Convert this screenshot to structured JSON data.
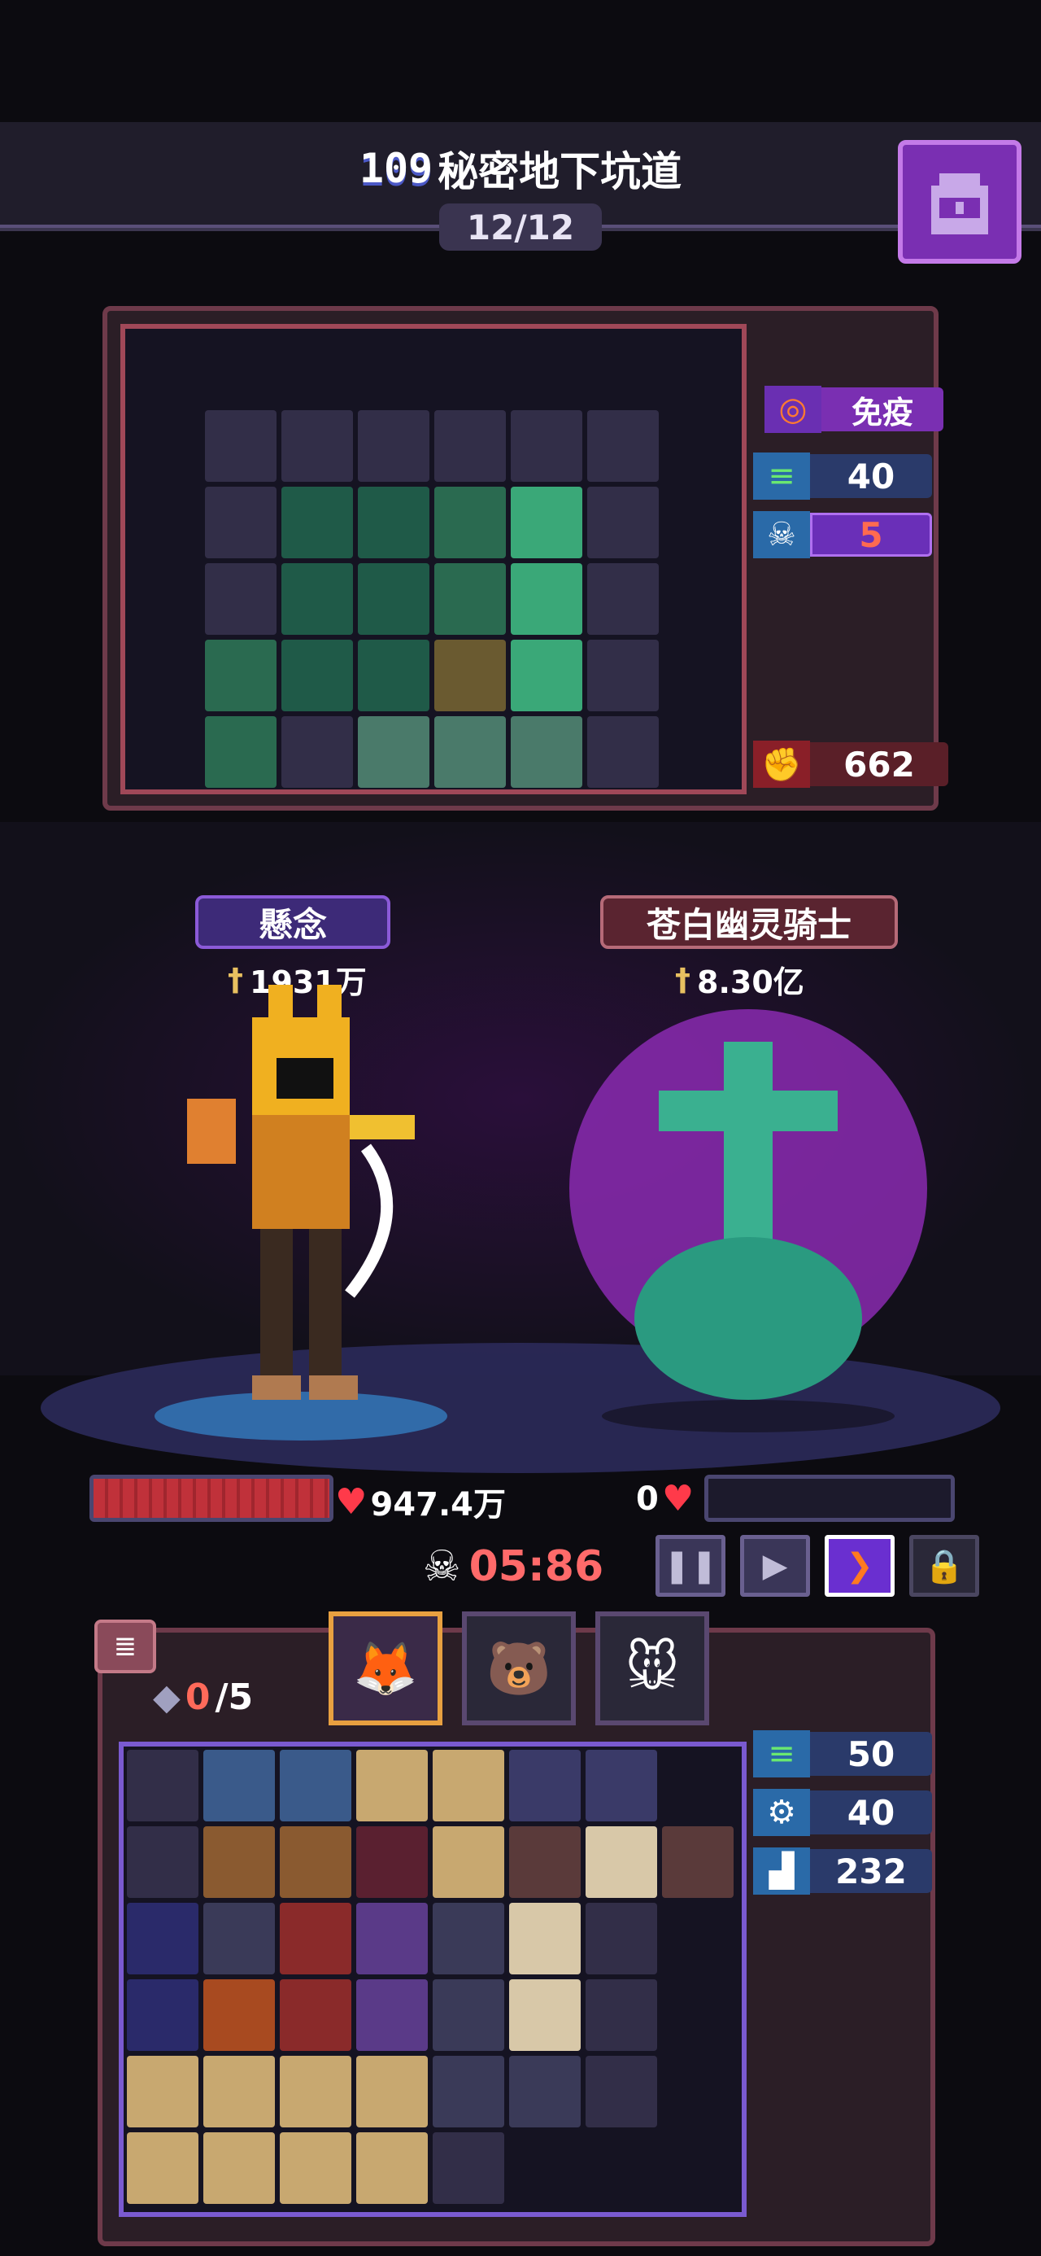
{
  "header": {
    "level": "109",
    "dungeon_name": "秘密地下坑道",
    "floor_progress": "12/12"
  },
  "enemy_stats": {
    "immune_label": "免疫",
    "speed": "40",
    "kills": "5",
    "attack": "662"
  },
  "player": {
    "name": "懸念",
    "power": "1931万",
    "hp": "947.4万",
    "hp_fraction": 1.0
  },
  "enemy": {
    "name": "苍白幽灵骑士",
    "power": "8.30亿",
    "hp": "0",
    "hp_fraction": 0
  },
  "battle": {
    "timer": "05:86"
  },
  "inventory": {
    "slots_used": "0",
    "slots_total": "/5",
    "speed": "50",
    "defense": "40",
    "stamina": "232"
  },
  "colors": {
    "accent_purple": "#7a2fb2",
    "hp_red": "#c0313a",
    "timer_red": "#ff6a6a"
  },
  "icons": {
    "bag": "backpack-icon",
    "pause": "pause-icon",
    "play": "play-icon",
    "fast_forward": "fast-forward-icon",
    "lock": "lock-icon",
    "skull": "skull-icon",
    "heart": "heart-icon",
    "sword": "sword-icon"
  }
}
